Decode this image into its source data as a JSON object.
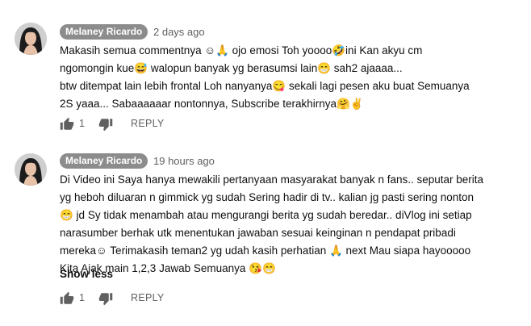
{
  "comments": [
    {
      "author": "Melaney Ricardo",
      "time": "2 days ago",
      "lines": [
        "Makasih semua commentnya ☺🙏 ojo emosi Toh yoooo🤣ini Kan akyu cm",
        "ngomongin kue😅 walopun banyak yg berasumsi lain😁 sah2 ajaaaa...",
        "btw ditempat lain lebih frontal Loh nanyanya😋 sekali lagi pesen aku buat Semuanya",
        "2S yaaa... Sabaaaaaar nontonnya, Subscribe terakhirnya🤗✌"
      ],
      "likes": "1",
      "reply_label": "REPLY"
    },
    {
      "author": "Melaney Ricardo",
      "time": "19 hours ago",
      "lines": [
        "Di Video ini Saya hanya mewakili pertanyaan masyarakat banyak n fans.. seputar berita",
        "yg heboh diluaran n gimmick yg sudah Sering hadir di tv.. kalian jg pasti sering nonton",
        "😁 jd Sy tidak menambah atau mengurangi berita yg sudah beredar.. diVlog ini setiap",
        "narasumber berhak utk menentukan jawaban sesuai keinginan n pendapat pribadi",
        "mereka☺ Terimakasih teman2 yg udah kasih perhatian 🙏 next Mau siapa hayooooo",
        "Kita Ajak main 1,2,3 Jawab Semuanya 😘😁"
      ],
      "show_less": "Show less",
      "likes": "1",
      "reply_label": "REPLY"
    }
  ],
  "icons": {
    "like": "thumb-up-icon",
    "dislike": "thumb-down-icon"
  },
  "colors": {
    "author_badge": "#8c8c8c",
    "meta_text": "#606060",
    "body_text": "#0f0f0f"
  }
}
